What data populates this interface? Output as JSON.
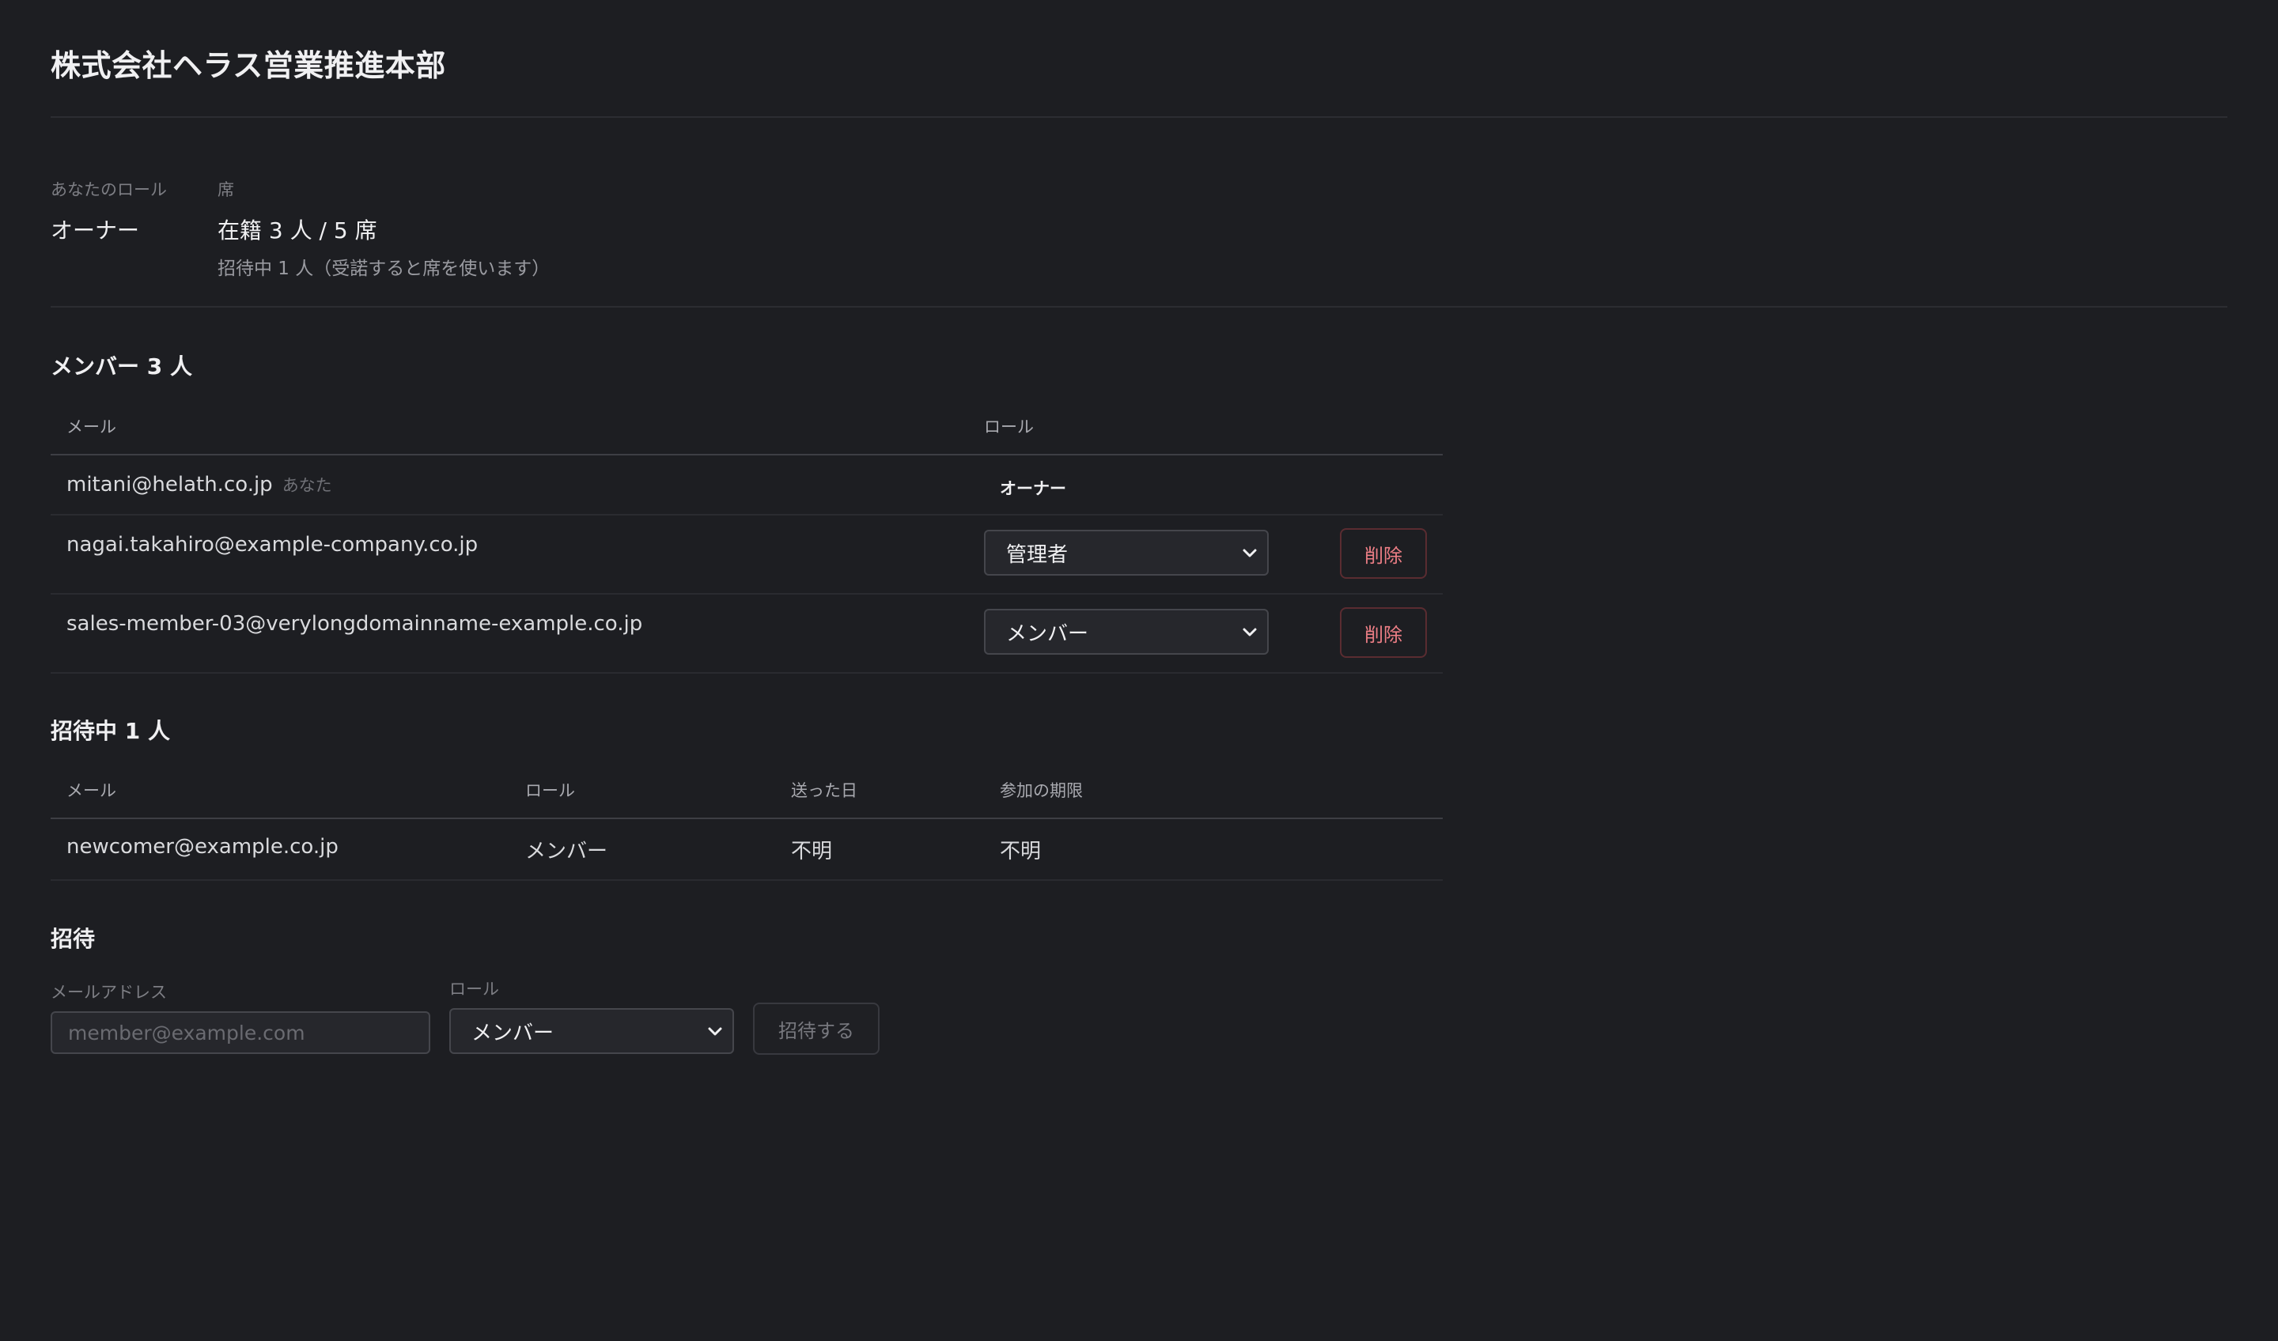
{
  "org": {
    "title": "株式会社ヘラス営業推進本部"
  },
  "summary": {
    "role_label": "あなたのロール",
    "role_value": "オーナー",
    "seats_label": "席",
    "seats_value": "在籍 3 人 / 5 席",
    "seats_note": "招待中 1 人（受諾すると席を使います）"
  },
  "members": {
    "title": "メンバー 3 人",
    "columns": {
      "email": "メール",
      "role": "ロール"
    },
    "rows": [
      {
        "email": "mitani@helath.co.jp",
        "you_tag": "あなた",
        "role": "オーナー"
      },
      {
        "email": "nagai.takahiro@example-company.co.jp",
        "role": "管理者",
        "delete_label": "削除"
      },
      {
        "email": "sales-member-03@verylongdomainname-example.co.jp",
        "role": "メンバー",
        "delete_label": "削除"
      }
    ]
  },
  "invites": {
    "title": "招待中 1 人",
    "columns": {
      "email": "メール",
      "role": "ロール",
      "sent": "送った日",
      "expires": "参加の期限"
    },
    "rows": [
      {
        "email": "newcomer@example.co.jp",
        "role": "メンバー",
        "sent": "不明",
        "expires": "不明"
      }
    ]
  },
  "invite_form": {
    "title": "招待",
    "email_label": "メールアドレス",
    "email_placeholder": "member@example.com",
    "email_value": "",
    "role_label": "ロール",
    "role_value": "メンバー",
    "submit_label": "招待する"
  },
  "icons": {
    "select_chevron": "chevron-down-icon"
  },
  "colors": {
    "background": "#1d1e22",
    "danger": "#ee7f86",
    "danger_border": "#5a2c31"
  }
}
